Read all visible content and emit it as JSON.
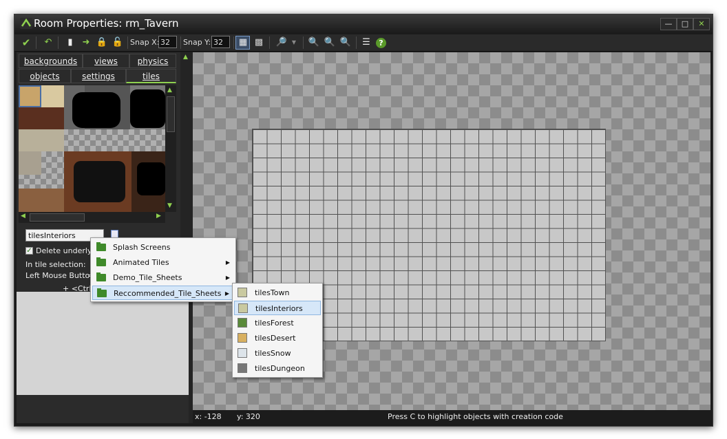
{
  "window": {
    "title": "Room Properties: rm_Tavern"
  },
  "toolbar": {
    "snap_x_label": "Snap X:",
    "snap_x_value": "32",
    "snap_y_label": "Snap Y:",
    "snap_y_value": "32"
  },
  "tabs": {
    "row1": [
      "backgrounds",
      "views",
      "physics"
    ],
    "row2": [
      "objects",
      "settings",
      "tiles"
    ],
    "active": "tiles"
  },
  "tile_panel": {
    "background_field": "tilesInteriors",
    "delete_underlying_label": "Delete underlying",
    "delete_underlying_checked": true,
    "in_tile_selection_label": "In tile selection:",
    "left_mouse_label": "Left Mouse Button",
    "left_mouse_suffix": "=",
    "ctrl_label": "+ <Ctrl>"
  },
  "context_menu": {
    "items": [
      {
        "label": "Splash Screens",
        "has_submenu": false
      },
      {
        "label": "Animated Tiles",
        "has_submenu": true
      },
      {
        "label": "Demo_Tile_Sheets",
        "has_submenu": true
      },
      {
        "label": "Reccommended_Tile_Sheets",
        "has_submenu": true,
        "highlighted": true
      }
    ]
  },
  "submenu": {
    "items": [
      {
        "label": "tilesTown"
      },
      {
        "label": "tilesInteriors",
        "highlighted": true
      },
      {
        "label": "tilesForest"
      },
      {
        "label": "tilesDesert"
      },
      {
        "label": "tilesSnow"
      },
      {
        "label": "tilesDungeon"
      }
    ]
  },
  "status": {
    "x": "x: -128",
    "y": "y: 320",
    "message": "Press C to highlight objects with creation code"
  },
  "colors": {
    "accent_green": "#8fd14f",
    "menu_highlight": "#d6e7f8",
    "window_bg": "#1b1b1b"
  }
}
